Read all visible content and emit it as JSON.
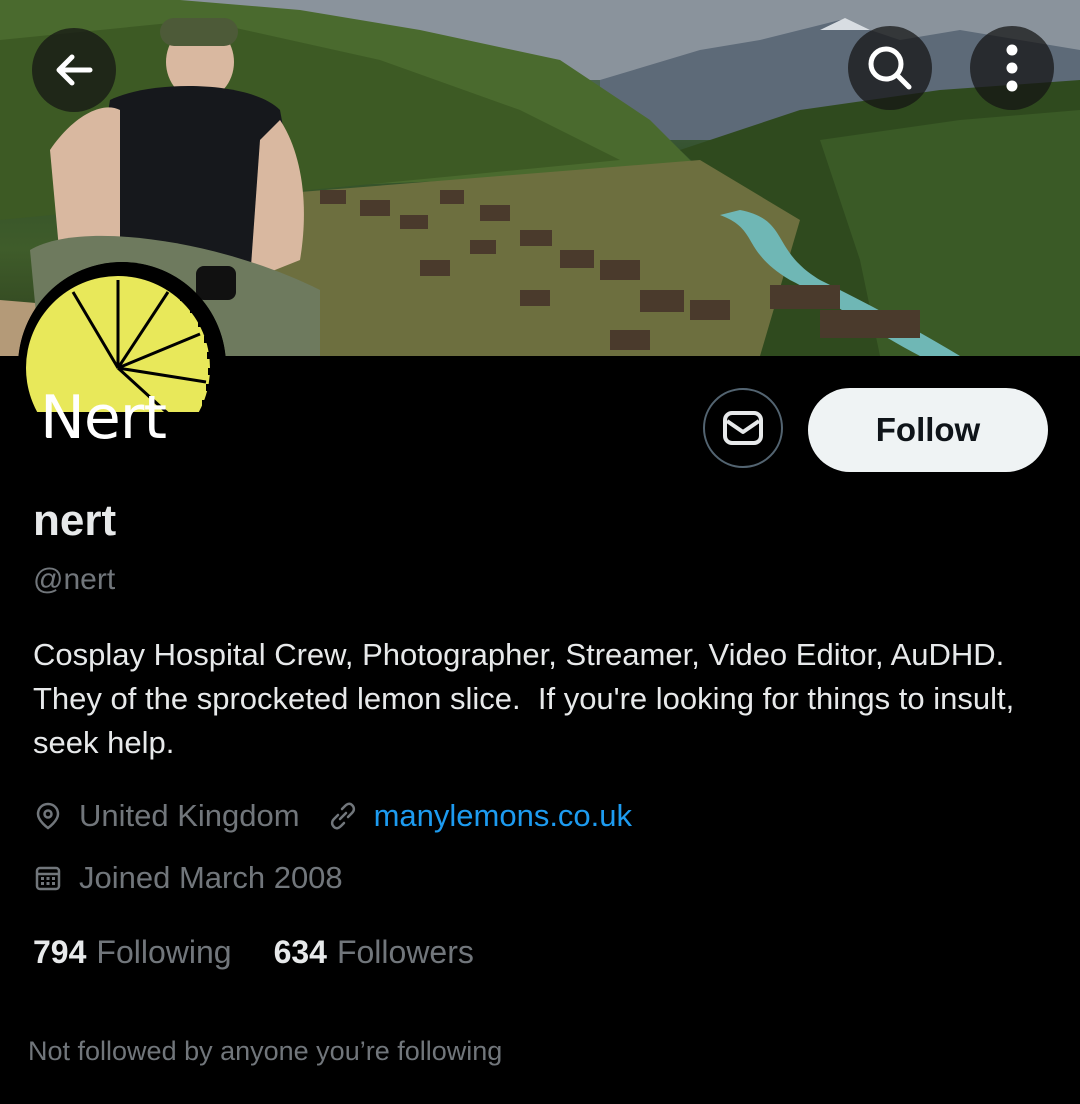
{
  "header": {
    "back_icon": "arrow-left-icon",
    "search_icon": "search-icon",
    "more_icon": "more-vertical-icon"
  },
  "avatar": {
    "text": "Nert",
    "colors": {
      "lemon": "#e8e85a",
      "rind": "#000000"
    }
  },
  "actions": {
    "message_icon": "envelope-icon",
    "follow_label": "Follow"
  },
  "profile": {
    "display_name": "nert",
    "handle": "@nert",
    "bio": "Cosplay Hospital Crew, Photographer, Streamer, Video Editor, AuDHD. They of the sprocketed lemon slice.  If you're looking for things to insult, seek help.",
    "location": "United Kingdom",
    "website": "manylemons.co.uk",
    "joined": "Joined March 2008"
  },
  "stats": {
    "following_count": "794",
    "following_label": "Following",
    "followers_count": "634",
    "followers_label": "Followers"
  },
  "footer": {
    "not_followed_text": "Not followed by anyone you’re following"
  },
  "colors": {
    "background": "#000000",
    "primary_text": "#e7e9ea",
    "secondary_text": "#71767b",
    "link": "#1d9bf0",
    "follow_button_bg": "#eff3f4"
  }
}
